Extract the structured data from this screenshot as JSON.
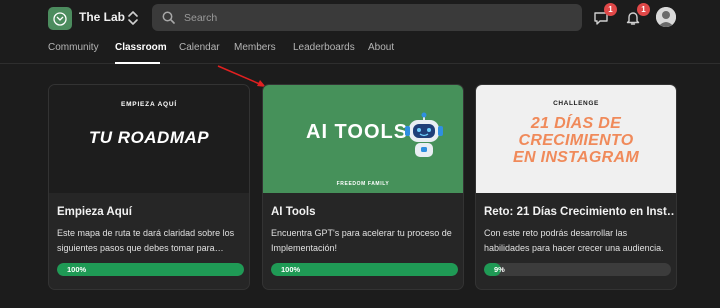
{
  "header": {
    "brand": "The Lab",
    "search": {
      "placeholder": "Search"
    },
    "chat_badge": "1",
    "notification_badge": "1",
    "icons": [
      "logo-icon",
      "switcher-icon",
      "search-icon",
      "chat-icon",
      "bell-icon",
      "avatar"
    ]
  },
  "nav": {
    "tabs": [
      {
        "label": "Community"
      },
      {
        "label": "Classroom",
        "active": true
      },
      {
        "label": "Calendar"
      },
      {
        "label": "Members"
      },
      {
        "label": "Leaderboards"
      },
      {
        "label": "About"
      }
    ]
  },
  "cards": [
    {
      "thumb_kicker": "EMPIEZA AQUÍ",
      "thumb_title": "TU ROADMAP",
      "title": "Empieza Aquí",
      "description": "Este mapa de ruta te dará claridad sobre los siguientes pasos que debes tomar para…",
      "progress": 100,
      "progress_label": "100%"
    },
    {
      "thumb_title": "AI TOOLS",
      "thumb_footer": "FREEDOM FAMILY",
      "title": "AI Tools",
      "description": "Encuentra GPT's para acelerar tu proceso de Implementación!",
      "progress": 100,
      "progress_label": "100%"
    },
    {
      "thumb_kicker": "CHALLENGE",
      "thumb_title_lines": [
        "21 DÍAS DE",
        "CRECIMIENTO",
        "EN INSTAGRAM"
      ],
      "title": "Reto: 21 Días Crecimiento en Inst…",
      "description": "Con este reto podrás desarrollar las habilidades para hacer crecer una audiencia.",
      "progress": 9,
      "progress_label": "9%"
    }
  ],
  "colors": {
    "background": "#1c1c1c",
    "card": "#262626",
    "progress_fill": "#1f9a55",
    "badge": "#e04848",
    "ai_tools_bg": "#46915a",
    "challenge_title": "#f08a5a",
    "arrow": "#e02020"
  }
}
